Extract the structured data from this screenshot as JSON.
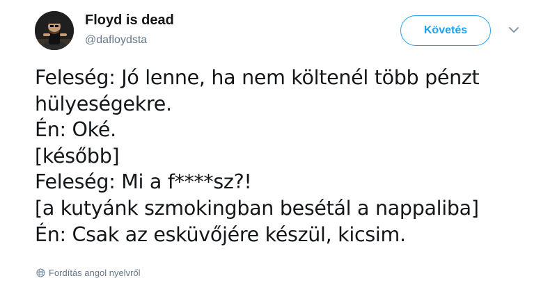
{
  "author": {
    "name": "Floyd is dead",
    "handle": "@dafloydsta",
    "avatar_icon": "user-avatar"
  },
  "follow_button": {
    "label": "Követés"
  },
  "menu": {
    "icon": "chevron-down-icon"
  },
  "tweet": {
    "lines": [
      "Feleség: Jó lenne, ha nem költenél több pénzt",
      "hülyeségekre.",
      "Én: Oké.",
      "[később]",
      "Feleség: Mi a f****sz?!",
      "[a kutyánk szmokingban besétál a nappaliba]",
      "Én: Csak az esküvőjére készül, kicsim."
    ]
  },
  "translate": {
    "label": "Fordítás angol nyelvről",
    "icon": "globe-icon"
  },
  "colors": {
    "accent": "#1da1f2",
    "text": "#14171a",
    "secondary": "#657786"
  }
}
